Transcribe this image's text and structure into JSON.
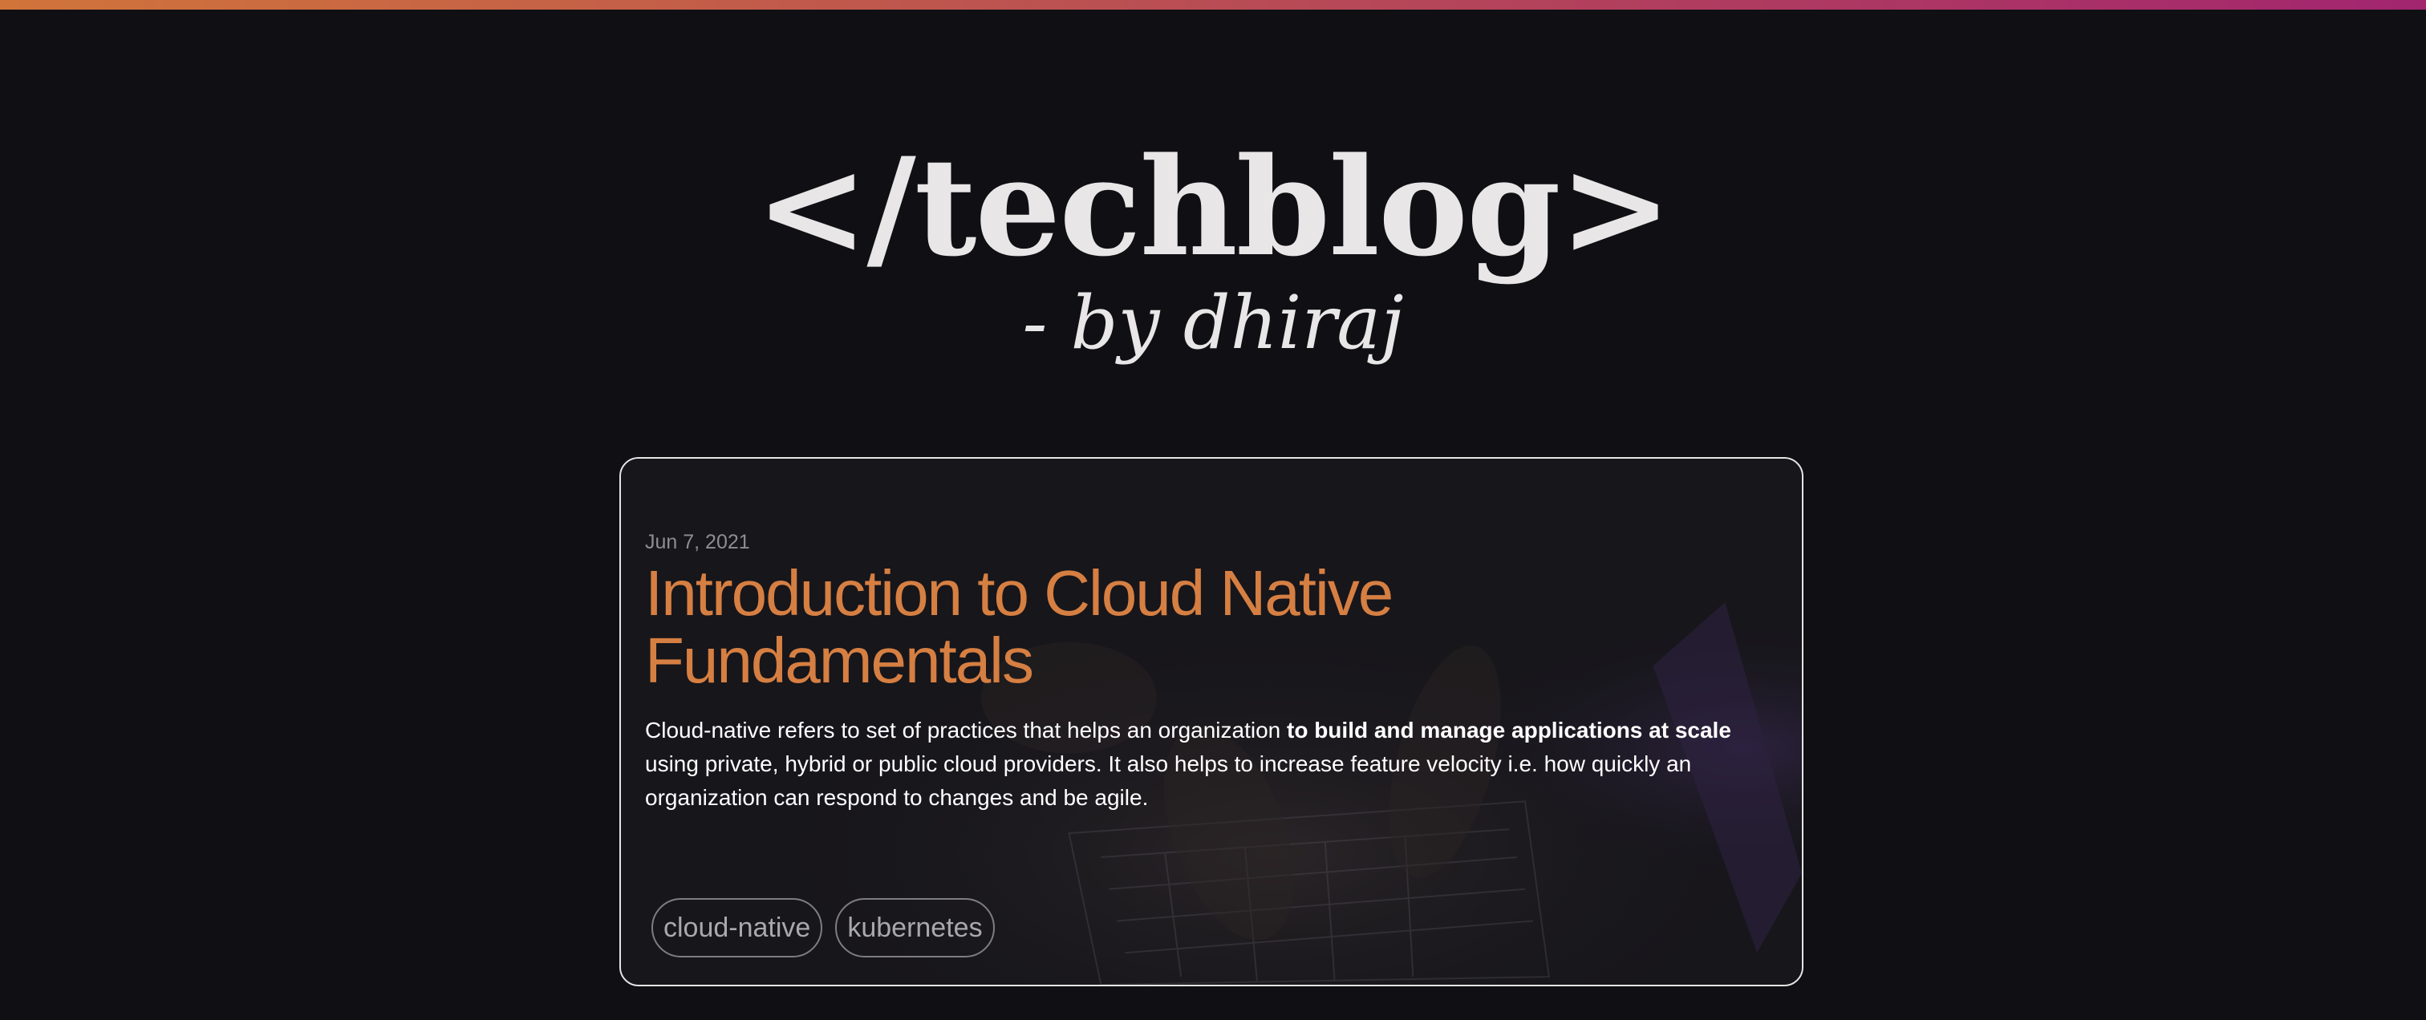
{
  "colors": {
    "background": "#0f0f14",
    "accent_gradient_start": "#d0743a",
    "accent_gradient_end": "#a2256f",
    "post_title": "#d67f42",
    "card_border": "#e5e5e5"
  },
  "header": {
    "title": "</techblog>",
    "subtitle": "- by dhiraj"
  },
  "post": {
    "date": "Jun 7, 2021",
    "title": "Introduction to Cloud Native Fundamentals",
    "excerpt_before": "Cloud-native refers to set of practices that helps an organization ",
    "excerpt_bold": "to build and manage applications at scale",
    "excerpt_after": " using private, hybrid or public cloud providers. It also helps to increase feature velocity i.e. how quickly an organization can respond to changes and be agile.",
    "background_image": "dark photo of hands typing on a laptop keyboard",
    "tags": [
      "cloud-native",
      "kubernetes"
    ]
  }
}
